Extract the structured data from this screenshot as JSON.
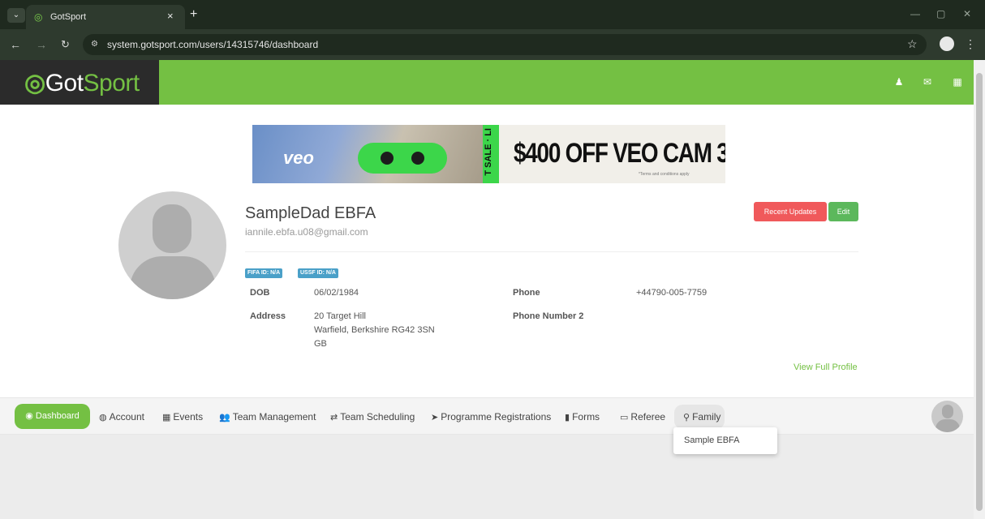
{
  "browser": {
    "tab_title": "GotSport",
    "url": "system.gotsport.com/users/14315746/dashboard",
    "icons": [
      "chevron-down-icon",
      "close-icon",
      "plus-icon",
      "back-icon",
      "forward-icon",
      "reload-icon",
      "site-info-icon",
      "star-icon",
      "profile-icon",
      "kebab-icon",
      "minimize-icon",
      "maximize-icon",
      "window-close-icon"
    ]
  },
  "header": {
    "logo_got": "Got",
    "logo_sport": "Sport",
    "icons": [
      "user-icon",
      "envelope-icon",
      "grid-icon"
    ],
    "brand_color": "#74c043"
  },
  "ad": {
    "logo": "veo",
    "strip_text": "T SALE · LI",
    "headline": "$400 OFF VEO CAM 3",
    "headline_mark": "*",
    "terms": "*Terms and conditions apply"
  },
  "profile": {
    "name": "SampleDad EBFA",
    "email": "iannile.ebfa.u08@gmail.com",
    "recent_updates_label": "Recent Updates",
    "edit_label": "Edit",
    "fifa_badge": "FIFA ID: N/A",
    "ussf_badge": "USSF ID: N/A",
    "dob_label": "DOB",
    "dob_value": "06/02/1984",
    "phone_label": "Phone",
    "phone_value": "+44790-005-7759",
    "address_label": "Address",
    "address_line1": "20 Target Hill",
    "address_line2": "Warfield, Berkshire RG42 3SN",
    "address_line3": "GB",
    "phone2_label": "Phone Number 2",
    "view_full_profile": "View Full Profile"
  },
  "nav": {
    "items": [
      {
        "label": "Dashboard",
        "icon": "dashboard-icon",
        "active": true
      },
      {
        "label": "Account",
        "icon": "account-icon"
      },
      {
        "label": "Events",
        "icon": "calendar-icon"
      },
      {
        "label": "Team Management",
        "icon": "users-icon"
      },
      {
        "label": "Team Scheduling",
        "icon": "exchange-icon"
      },
      {
        "label": "Programme Registrations",
        "icon": "paper-plane-icon"
      },
      {
        "label": "Forms",
        "icon": "file-icon"
      },
      {
        "label": "Referee",
        "icon": "calendar-outline-icon"
      },
      {
        "label": "Family",
        "icon": "sitemap-icon"
      }
    ],
    "dropdown_item": "Sample EBFA"
  }
}
